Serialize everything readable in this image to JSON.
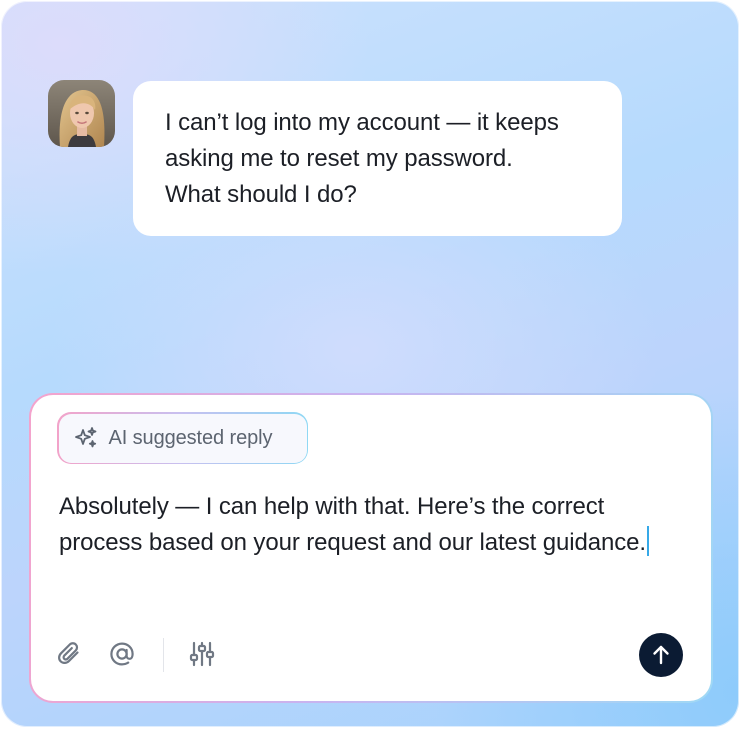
{
  "user_message": {
    "text": "I can’t log into my account — it keeps\nasking me to reset my password.\nWhat should I do?"
  },
  "composer": {
    "chip_label": "AI suggested reply",
    "reply_text": "Absolutely — I can help with that. Here’s the correct process based on your request and our latest guidance."
  },
  "icons": {
    "sparkle": "sparkle-icon",
    "attach": "paperclip-icon",
    "mention": "at-sign-icon",
    "settings": "sliders-icon",
    "send": "arrow-up-icon"
  },
  "colors": {
    "send_button": "#0b1b33",
    "caret": "#36a9e8",
    "chip_text": "#5c6470",
    "text": "#1c1f26"
  }
}
